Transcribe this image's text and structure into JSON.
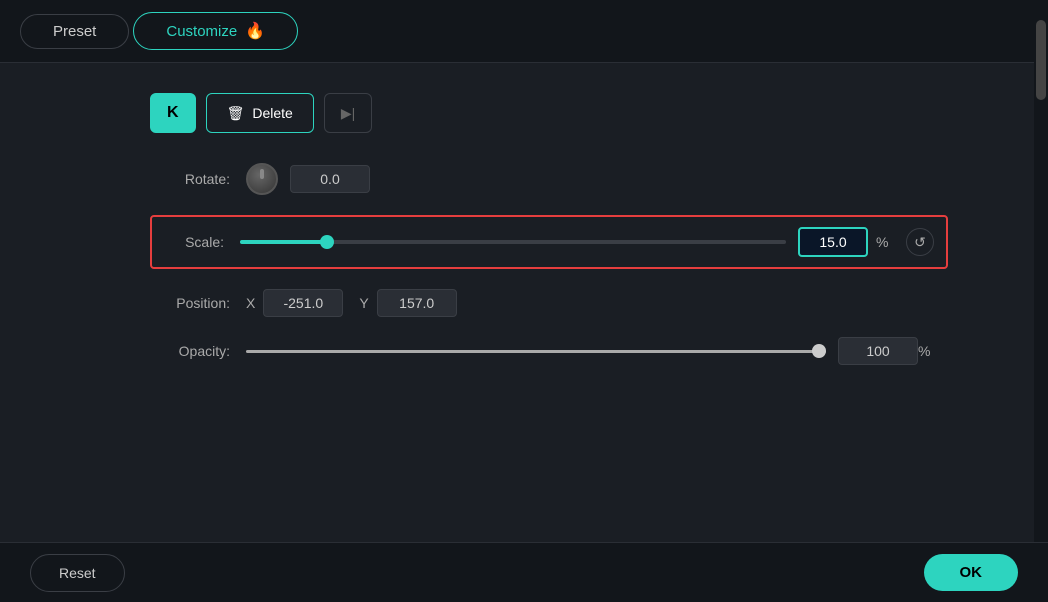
{
  "tabs": {
    "preset_label": "Preset",
    "customize_label": "Customize",
    "crown_emoji": "🔥"
  },
  "buttons": {
    "k_label": "K",
    "delete_label": "Delete",
    "next_label": "▶|"
  },
  "controls": {
    "rotate_label": "Rotate:",
    "rotate_value": "0.0",
    "scale_label": "Scale:",
    "scale_value": "15.0",
    "scale_unit": "%",
    "position_label": "Position:",
    "position_x_label": "X",
    "position_x_value": "-251.0",
    "position_y_label": "Y",
    "position_y_value": "157.0",
    "opacity_label": "Opacity:",
    "opacity_value": "100",
    "opacity_unit": "%"
  },
  "bottom": {
    "reset_label": "Reset",
    "ok_label": "OK"
  },
  "colors": {
    "accent": "#2dd4bf",
    "danger": "#e53e3e",
    "bg_dark": "#12161b",
    "bg_mid": "#1a1e24"
  }
}
